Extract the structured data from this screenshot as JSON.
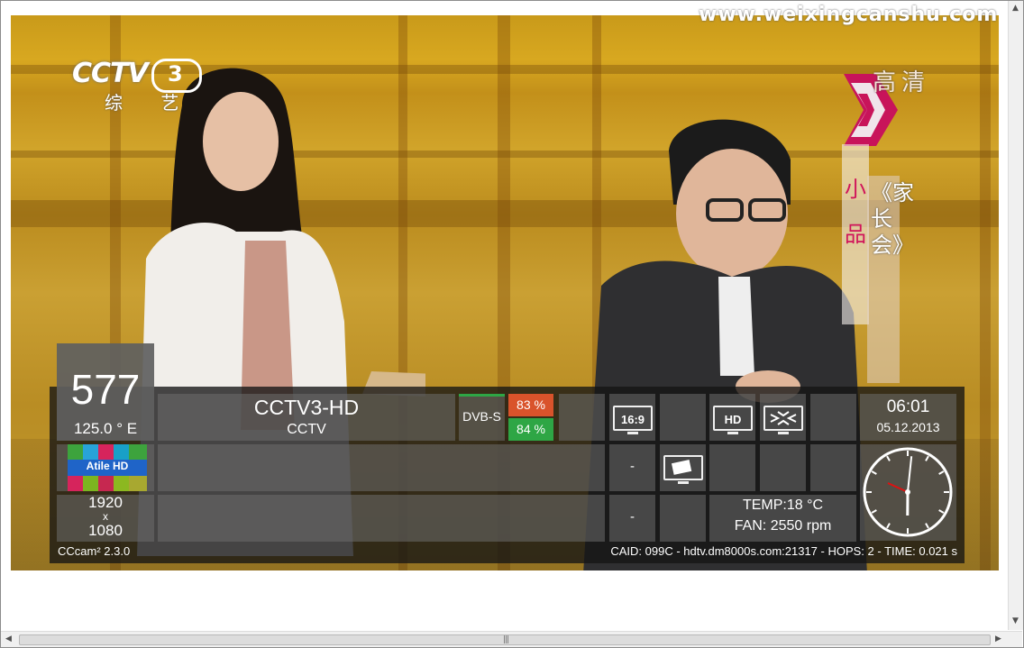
{
  "watermark": "www.weixingcanshu.com",
  "channel_logo": {
    "brand": "CCTV",
    "number": "3",
    "sub": "综  艺"
  },
  "overlay": {
    "badge": "高清",
    "category": "小品",
    "program": "《家长会》"
  },
  "infobar": {
    "channel_number": "577",
    "orbital_position": "125.0 ° E",
    "channel_name": "CCTV3-HD",
    "provider": "CCTV",
    "tuner_type": "DVB-S",
    "signal_quality": "83 %",
    "signal_strength": "84 %",
    "aspect_icon_label": "16:9",
    "hd_icon_label": "HD",
    "clock_time": "06:01",
    "clock_date": "05.12.2013",
    "satellite_logo_label": "Atile HD",
    "resolution_w": "1920",
    "resolution_x": "x",
    "resolution_h": "1080",
    "dash1": "-",
    "dash2": "-",
    "temperature": "TEMP:18 °C",
    "fan": "FAN: 2550 rpm",
    "softcam": "CCcam² 2.3.0",
    "ecm_info": "CAID: 099C - hdtv.dm8000s.com:21317 - HOPS: 2 - TIME: 0.021 s",
    "analog_clock": {
      "hour": 6,
      "minute": 1
    }
  },
  "colors": {
    "signal_quality": "#d9532b",
    "signal_strength": "#2ea645",
    "hand_second": "#e01010"
  },
  "icons": [
    "aspect-16-9-icon",
    "hd-icon",
    "dolby-icon",
    "tv-icon",
    "clock-icon"
  ]
}
